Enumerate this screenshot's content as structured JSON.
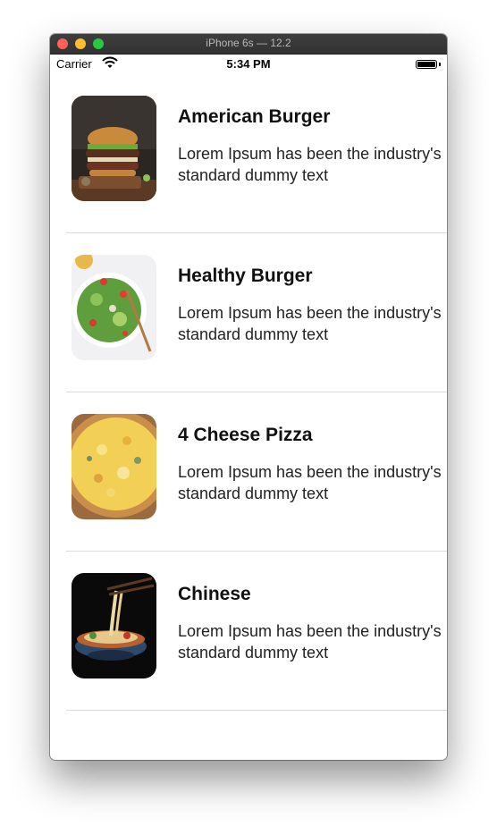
{
  "window": {
    "title": "iPhone 6s — 12.2"
  },
  "status_bar": {
    "carrier": "Carrier",
    "time": "5:34 PM"
  },
  "items": [
    {
      "title": "American Burger",
      "description": "Lorem Ipsum has been the industry's standard dummy text"
    },
    {
      "title": "Healthy Burger",
      "description": "Lorem Ipsum has been the industry's standard dummy text"
    },
    {
      "title": "4 Cheese Pizza",
      "description": "Lorem Ipsum has been the industry's standard dummy text"
    },
    {
      "title": "Chinese",
      "description": "Lorem Ipsum has been the industry's standard dummy text"
    }
  ]
}
